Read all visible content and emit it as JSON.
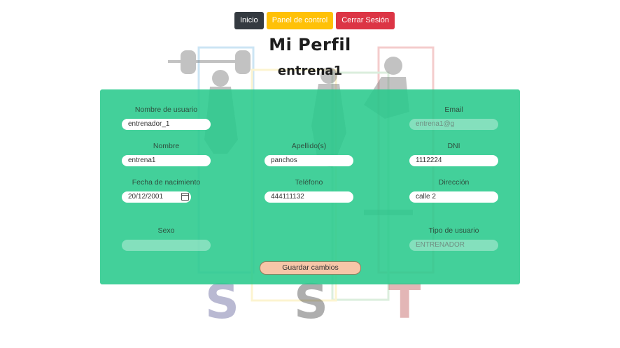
{
  "nav": {
    "inicio": "Inicio",
    "panel": "Panel de control",
    "logout": "Cerrar Sesión"
  },
  "page": {
    "title": "Mi Perfil",
    "subtitle": "entrena1"
  },
  "form": {
    "usuario": {
      "label": "Nombre de usuario",
      "value": "entrenador_1"
    },
    "email": {
      "label": "Email",
      "value": "entrena1@g",
      "disabled": true
    },
    "nombre": {
      "label": "Nombre",
      "value": "entrena1"
    },
    "apellidos": {
      "label": "Apellido(s)",
      "value": "panchos"
    },
    "dni": {
      "label": "DNI",
      "value": "1112224"
    },
    "fecha": {
      "label": "Fecha de nacimiento",
      "value": "20/12/2001",
      "icon": "calendar-icon"
    },
    "telefono": {
      "label": "Teléfono",
      "value": "444111132"
    },
    "direccion": {
      "label": "Dirección",
      "value": "calle 2"
    },
    "sexo": {
      "label": "Sexo",
      "value": "",
      "disabled": true
    },
    "tipo": {
      "label": "Tipo de usuario",
      "value": "ENTRENADOR",
      "disabled": true
    },
    "save": "Guardar cambios"
  },
  "colors": {
    "panel": "#29c98c",
    "inicio": "#343a40",
    "panel_btn": "#ffc107",
    "logout": "#dc3545",
    "save": "#f7c6a8"
  }
}
